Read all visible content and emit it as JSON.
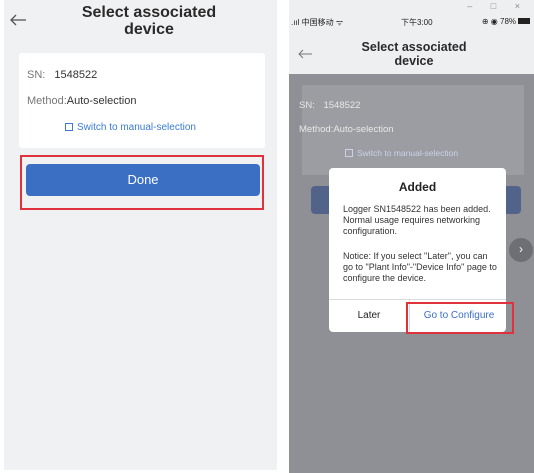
{
  "left_screen": {
    "title": "Select associated device",
    "sn_label": "SN:",
    "sn_value": "1548522",
    "method_label": "Method:",
    "method_value": "Auto-selection",
    "switch_link": "Switch to manual-selection",
    "done_button": "Done"
  },
  "right_screen": {
    "window_controls": "– □ ×",
    "status_bar": {
      "carrier": ".ııl 中国移动 ᯤ",
      "time": "下午3:00",
      "battery": "⊕ ◉ 78%"
    },
    "title": "Select associated device",
    "sn_label": "SN:",
    "sn_value": "1548522",
    "method_label": "Method:",
    "method_value": "Auto-selection",
    "switch_link": "Switch to manual-selection",
    "dialog": {
      "title": "Added",
      "message": "Logger SN1548522 has been added. Normal usage requires networking configuration.",
      "notice": "Notice: If you select \"Later\", you can go to \"Plant Info\"-\"Device Info\" page to configure the device.",
      "later_button": "Later",
      "configure_button": "Go to Configure"
    },
    "next_icon": "chevron-right-icon"
  },
  "colors": {
    "accent_blue": "#3a6fc4",
    "highlight_red": "#e0323c"
  }
}
